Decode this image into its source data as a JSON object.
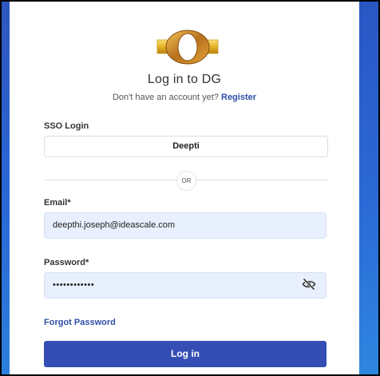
{
  "header": {
    "logo_icon": "dg-gold-ring-logo",
    "title": "Log in to DG",
    "subtitle_prefix": "Don't have an account yet?",
    "register_link": "Register"
  },
  "sso": {
    "label": "SSO Login",
    "button_label": "Deepti"
  },
  "divider": {
    "label": "OR"
  },
  "email": {
    "label": "Email*",
    "value": "deepthi.joseph@ideascale.com"
  },
  "password": {
    "label": "Password*",
    "value": "••••••••••••",
    "toggle_icon": "eye-slash-icon"
  },
  "forgot_link": "Forgot Password",
  "submit_label": "Log in",
  "colors": {
    "primary": "#344eb5",
    "link": "#2f4fa8",
    "input_bg": "#e8effd",
    "side_bg": "#2a66d3"
  }
}
